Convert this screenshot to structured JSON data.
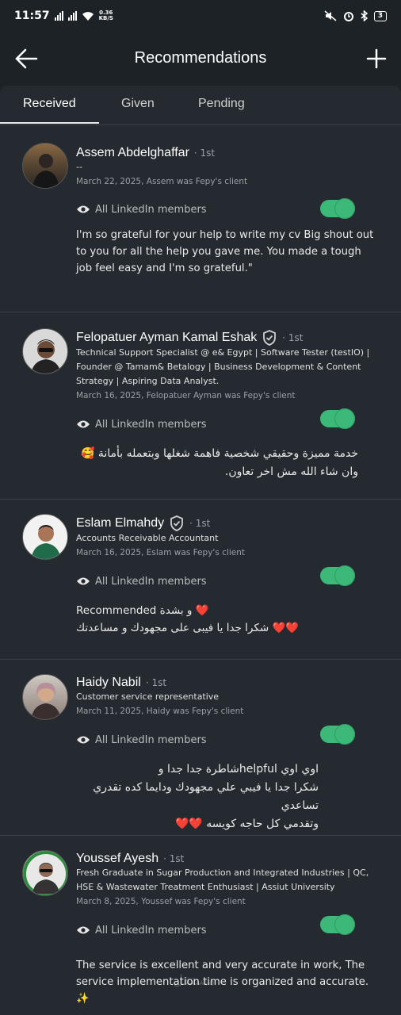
{
  "status": {
    "time": "11:57",
    "speed_value": "0.36",
    "speed_unit": "KB/S",
    "battery": "3"
  },
  "header": {
    "title": "Recommendations"
  },
  "tabs": [
    {
      "label": "Received"
    },
    {
      "label": "Given"
    },
    {
      "label": "Pending"
    }
  ],
  "recommendations": [
    {
      "name": "Assem Abdelghaffar",
      "degree": "· 1st",
      "headline": "--",
      "meta": "March 22, 2025, Assem was Fepy's client",
      "visibility": "All LinkedIn members",
      "text": "I'm so grateful for your help to write my cv Big shout out to you for all the help you gave me. You made a tough job feel easy and I'm so grateful.\"",
      "verified": false
    },
    {
      "name": "Felopatuer Ayman Kamal Eshak",
      "degree": "· 1st",
      "headline": "Technical Support Specialist @ e& Egypt | Software Tester (testIO) | Founder @ Tamam& Betalogy | Business Development & Content Strategy | Aspiring Data Analyst.",
      "meta": "March 16, 2025, Felopatuer Ayman was Fepy's client",
      "visibility": "All LinkedIn members",
      "text": "خدمة مميزة وحقيقي شخصية فاهمة شغلها وبتعمله بأمانة 🥰\nوان شاء الله مش اخر تعاون.",
      "verified": true
    },
    {
      "name": "Eslam Elmahdy",
      "degree": "· 1st",
      "headline": "Accounts Receivable Accountant",
      "meta": "March 16, 2025, Eslam was Fepy's client",
      "visibility": "All LinkedIn members",
      "text": "Recommended و بشدة ❤️\nشكرا جدا يا فيبى على مجهودك و مساعدتك ❤️❤️",
      "verified": true
    },
    {
      "name": "Haidy Nabil",
      "degree": "· 1st",
      "headline": "Customer service representative",
      "meta": "March 11, 2025, Haidy was Fepy's client",
      "visibility": "All LinkedIn members",
      "text": "اوي اوي helpfulشاطرة جدا جدا و\nشكرا جدا يا فيبي علي مجهودك ودايما كده تقدري تساعدي\nوتقدمي كل حاجه كويسه ❤️❤️",
      "verified": false
    },
    {
      "name": "Youssef Ayesh",
      "degree": "· 1st",
      "headline": "Fresh Graduate in Sugar Production and Integrated Industries | QC, HSE & Wastewater Treatment Enthusiast | Assiut University",
      "meta": "March 8, 2025, Youssef was Fepy's client",
      "visibility": "All LinkedIn members",
      "text": "The service is excellent and very accurate in work, The service implementation time is organized and accurate. ✨",
      "verified": false
    }
  ],
  "watermark": "مستقل"
}
